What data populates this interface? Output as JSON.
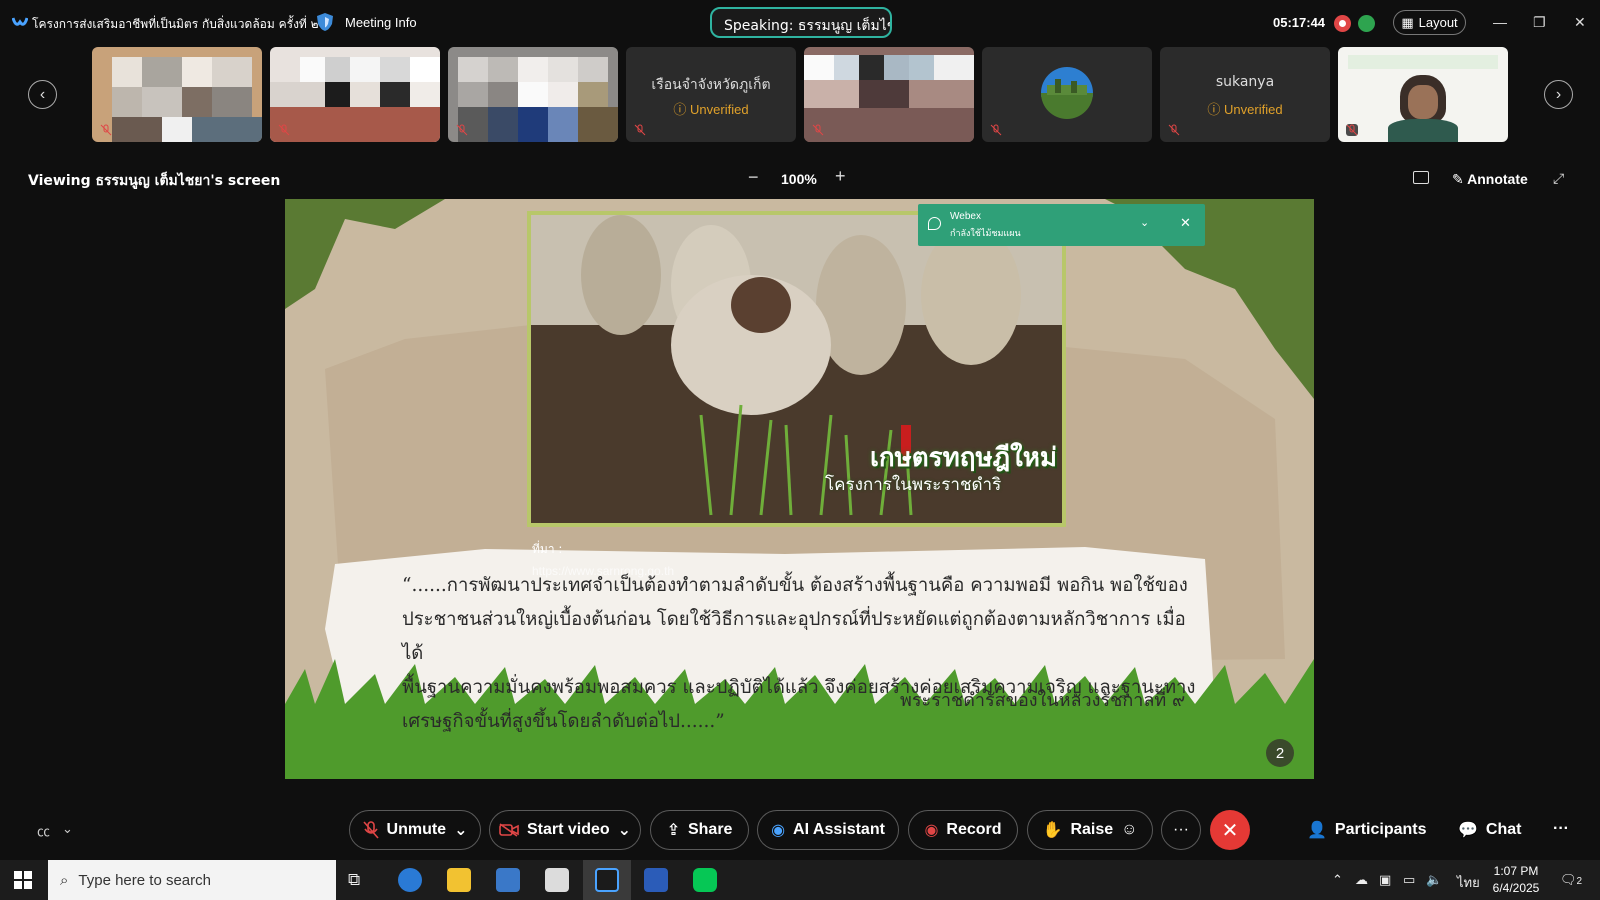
{
  "window": {
    "title": "โครงการส่งเสริมอาชีพที่เป็นมิตร กับสิ่งแวดล้อม ครั้งที่ ๒",
    "meeting_info": "Meeting Info",
    "speaking": "Speaking: ธรรมนูญ เต็มไชยา",
    "clock": "05:17:44",
    "layout_label": "Layout"
  },
  "participants": [
    {
      "name": "",
      "status": ""
    },
    {
      "name": "",
      "status": ""
    },
    {
      "name": "",
      "status": ""
    },
    {
      "name": "เรือนจำจังหวัดภูเก็ต",
      "status": "Unverified"
    },
    {
      "name": "",
      "status": ""
    },
    {
      "name": "",
      "status": ""
    },
    {
      "name": "sukanya",
      "status": "Unverified"
    },
    {
      "name": "",
      "status": ""
    }
  ],
  "share": {
    "viewing": "Viewing ธรรมนูญ เต็มไชยา's screen",
    "zoom": "100%",
    "annotate": "Annotate"
  },
  "slide": {
    "caption_title": "เกษตรทฤษฎีใหม่",
    "caption_sub": "โครงการในพระราชดำริ",
    "source_label": "ที่มา :",
    "source_url": "https://www.sarnrong.go.th",
    "quote": "“......การพัฒนาประเทศจำเป็นต้องทำตามลำดับขั้น ต้องสร้างพื้นฐานคือ ความพอมี พอกิน พอใช้ของ\nประชาชนส่วนใหญ่เบื้องต้นก่อน โดยใช้วิธีการและอุปกรณ์ที่ประหยัดแต่ถูกต้องตามหลักวิชาการ เมื่อได้\nพื้นฐานความมั่นคงพร้อมพอสมควร และปฏิบัติได้แล้ว จึงค่อยสร้างค่อยเสริมความเจริญ และฐานะทาง\nเศรษฐกิจขั้นที่สูงขึ้นโดยลำดับต่อไป......”",
    "attribution": "พระราชดำรัสของในหลวงรัชกาลที่ ๙",
    "page": "2"
  },
  "toast": {
    "title": "Webex",
    "message": "กำลังใช้ไม้ชมแผน"
  },
  "controls": {
    "unmute": "Unmute",
    "start_video": "Start video",
    "share": "Share",
    "ai": "AI Assistant",
    "record": "Record",
    "raise": "Raise",
    "participants": "Participants",
    "chat": "Chat"
  },
  "taskbar": {
    "search_placeholder": "Type here to search",
    "lang": "ไทย",
    "time": "1:07 PM",
    "date": "6/4/2025",
    "notif": "2"
  },
  "colors": {
    "accent": "#2fb3a0",
    "danger": "#e53935",
    "warning": "#e0a12a",
    "slide_green": "#5a7a33"
  }
}
